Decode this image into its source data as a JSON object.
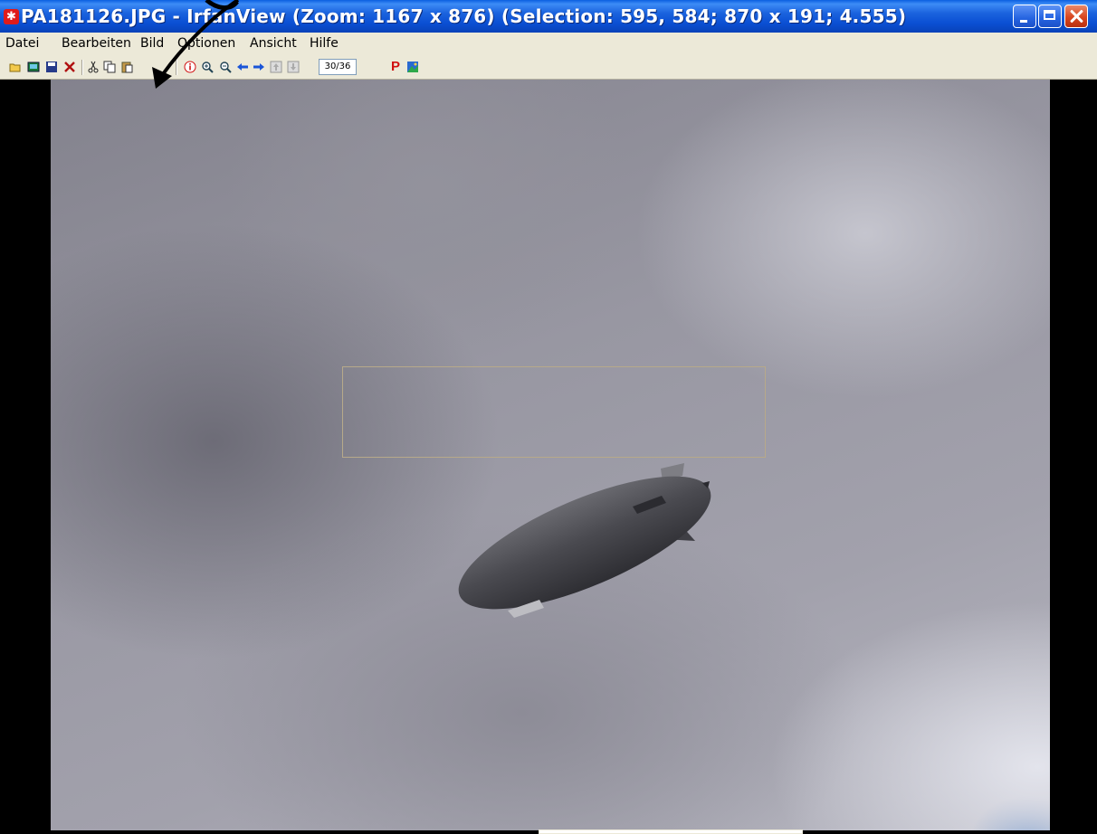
{
  "window": {
    "title": "PA181126.JPG - IrfanView (Zoom: 1167 x 876) (Selection: 595, 584; 870 x 191; 4.555)",
    "app_icon": "irfanview-icon"
  },
  "menu": {
    "items": [
      "Datei",
      "Bearbeiten",
      "Bild",
      "Optionen",
      "Ansicht",
      "Hilfe"
    ]
  },
  "toolbar": {
    "page_counter": "30/36",
    "icons": [
      "open-icon",
      "slideshow-icon",
      "save-icon",
      "delete-icon",
      "cut-icon",
      "copy-icon",
      "paste-icon",
      "info-icon",
      "zoom-in-icon",
      "zoom-out-icon",
      "previous-icon",
      "next-icon",
      "first-page-icon",
      "last-page-icon",
      "print-icon",
      "toggle-icon"
    ],
    "p_label": "P"
  },
  "annotation": {
    "arrow": "arrow-pointer"
  },
  "colors": {
    "titlebar": "#0b50d4",
    "chrome": "#ece9d8",
    "close": "#d9461f"
  }
}
